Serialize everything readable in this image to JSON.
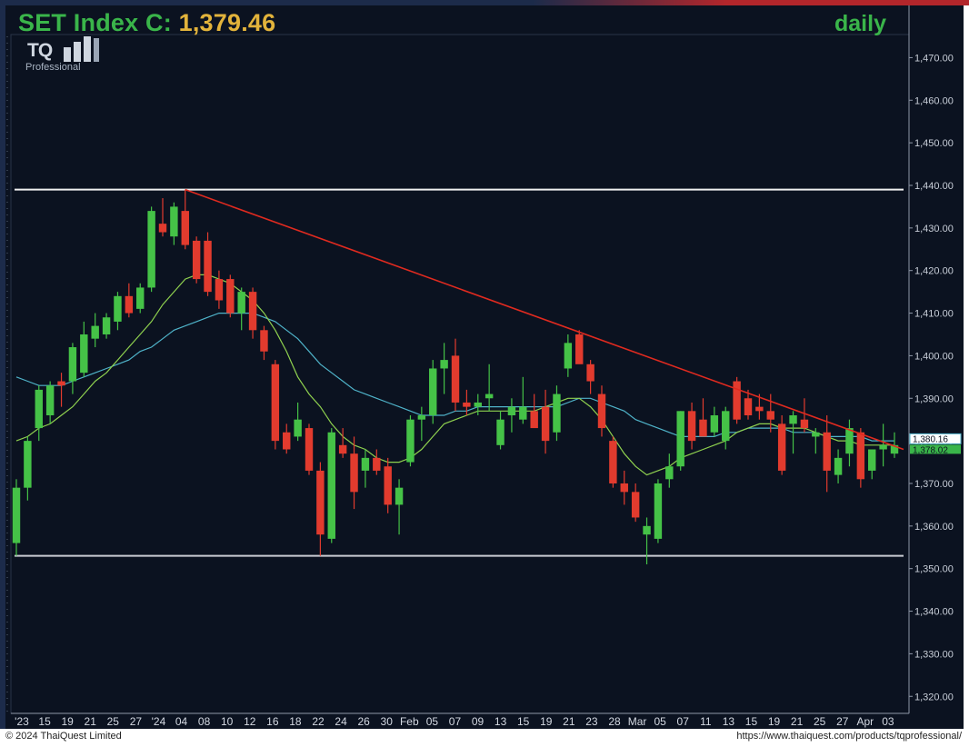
{
  "header": {
    "title_label": "SET Index C: ",
    "close_value": "1,379.46",
    "interval": "daily"
  },
  "logo": {
    "mark": "TQ",
    "subtitle": "Professional"
  },
  "footer": {
    "copyright": "© 2024 ThaiQuest Limited",
    "url": "https://www.thaiquest.com/products/tqprofessional/"
  },
  "colors": {
    "background": "#0b1220",
    "up": "#45c247",
    "down": "#e23b2e",
    "ma_fast": "#8fd14f",
    "ma_slow": "#4fb3c9",
    "trendline": "#e02a1f",
    "level_line": "#e6e6e6",
    "title": "#e2b33b"
  },
  "chart_data": {
    "type": "candlestick",
    "title": "SET Index C: 1,379.46",
    "interval": "daily",
    "ylim": [
      1316,
      1475
    ],
    "y_ticks": [
      "1,470.00",
      "1,460.00",
      "1,450.00",
      "1,440.00",
      "1,430.00",
      "1,420.00",
      "1,410.00",
      "1,400.00",
      "1,390.00",
      "1,380.00",
      "1,370.00",
      "1,360.00",
      "1,350.00",
      "1,340.00",
      "1,330.00",
      "1,320.00"
    ],
    "x_labels": [
      "'23",
      "15",
      "19",
      "21",
      "25",
      "27",
      "'24",
      "04",
      "08",
      "10",
      "12",
      "16",
      "18",
      "22",
      "24",
      "26",
      "30",
      "Feb",
      "05",
      "07",
      "09",
      "13",
      "15",
      "19",
      "21",
      "23",
      "28",
      "Mar",
      "05",
      "07",
      "11",
      "13",
      "15",
      "19",
      "21",
      "25",
      "27",
      "Apr",
      "03"
    ],
    "last_value_labels": [
      "1,380.16",
      "1,378.02"
    ],
    "candles": [
      {
        "o": 1356,
        "h": 1371,
        "l": 1353,
        "c": 1369
      },
      {
        "o": 1369,
        "h": 1381,
        "l": 1366,
        "c": 1380
      },
      {
        "o": 1383,
        "h": 1393,
        "l": 1380,
        "c": 1392
      },
      {
        "o": 1386,
        "h": 1394,
        "l": 1384,
        "c": 1393
      },
      {
        "o": 1394,
        "h": 1396,
        "l": 1388,
        "c": 1393
      },
      {
        "o": 1394,
        "h": 1403,
        "l": 1391,
        "c": 1402
      },
      {
        "o": 1396,
        "h": 1408,
        "l": 1395,
        "c": 1405
      },
      {
        "o": 1404,
        "h": 1410,
        "l": 1402,
        "c": 1407
      },
      {
        "o": 1405,
        "h": 1410,
        "l": 1404,
        "c": 1409
      },
      {
        "o": 1408,
        "h": 1415,
        "l": 1406,
        "c": 1414
      },
      {
        "o": 1414,
        "h": 1417,
        "l": 1409,
        "c": 1410
      },
      {
        "o": 1411,
        "h": 1417,
        "l": 1410,
        "c": 1416
      },
      {
        "o": 1416,
        "h": 1435,
        "l": 1415,
        "c": 1434
      },
      {
        "o": 1431,
        "h": 1437,
        "l": 1428,
        "c": 1429
      },
      {
        "o": 1428,
        "h": 1436,
        "l": 1426,
        "c": 1435
      },
      {
        "o": 1434,
        "h": 1439,
        "l": 1425,
        "c": 1426
      },
      {
        "o": 1427,
        "h": 1428,
        "l": 1417,
        "c": 1418
      },
      {
        "o": 1427,
        "h": 1429,
        "l": 1414,
        "c": 1415
      },
      {
        "o": 1418,
        "h": 1420,
        "l": 1411,
        "c": 1413
      },
      {
        "o": 1418,
        "h": 1419,
        "l": 1409,
        "c": 1410
      },
      {
        "o": 1410,
        "h": 1416,
        "l": 1406,
        "c": 1415
      },
      {
        "o": 1415,
        "h": 1416,
        "l": 1404,
        "c": 1406
      },
      {
        "o": 1406,
        "h": 1407,
        "l": 1399,
        "c": 1401
      },
      {
        "o": 1398,
        "h": 1399,
        "l": 1378,
        "c": 1380
      },
      {
        "o": 1382,
        "h": 1384,
        "l": 1377,
        "c": 1378
      },
      {
        "o": 1381,
        "h": 1389,
        "l": 1380,
        "c": 1385
      },
      {
        "o": 1383,
        "h": 1384,
        "l": 1372,
        "c": 1373
      },
      {
        "o": 1373,
        "h": 1375,
        "l": 1353,
        "c": 1358
      },
      {
        "o": 1357,
        "h": 1383,
        "l": 1356,
        "c": 1382
      },
      {
        "o": 1379,
        "h": 1383,
        "l": 1376,
        "c": 1377
      },
      {
        "o": 1377,
        "h": 1381,
        "l": 1364,
        "c": 1368
      },
      {
        "o": 1373,
        "h": 1378,
        "l": 1369,
        "c": 1376
      },
      {
        "o": 1376,
        "h": 1378,
        "l": 1372,
        "c": 1373
      },
      {
        "o": 1374,
        "h": 1376,
        "l": 1363,
        "c": 1365
      },
      {
        "o": 1365,
        "h": 1371,
        "l": 1358,
        "c": 1369
      },
      {
        "o": 1375,
        "h": 1386,
        "l": 1374,
        "c": 1385
      },
      {
        "o": 1385,
        "h": 1388,
        "l": 1380,
        "c": 1386
      },
      {
        "o": 1386,
        "h": 1399,
        "l": 1384,
        "c": 1397
      },
      {
        "o": 1397,
        "h": 1403,
        "l": 1391,
        "c": 1399
      },
      {
        "o": 1400,
        "h": 1404,
        "l": 1387,
        "c": 1389
      },
      {
        "o": 1389,
        "h": 1392,
        "l": 1386,
        "c": 1388
      },
      {
        "o": 1388,
        "h": 1391,
        "l": 1386,
        "c": 1389
      },
      {
        "o": 1390,
        "h": 1398,
        "l": 1387,
        "c": 1391
      },
      {
        "o": 1379,
        "h": 1387,
        "l": 1378,
        "c": 1385
      },
      {
        "o": 1386,
        "h": 1390,
        "l": 1382,
        "c": 1388
      },
      {
        "o": 1385,
        "h": 1395,
        "l": 1384,
        "c": 1388
      },
      {
        "o": 1387,
        "h": 1391,
        "l": 1385,
        "c": 1383
      },
      {
        "o": 1388,
        "h": 1392,
        "l": 1377,
        "c": 1380
      },
      {
        "o": 1382,
        "h": 1393,
        "l": 1380,
        "c": 1391
      },
      {
        "o": 1397,
        "h": 1405,
        "l": 1395,
        "c": 1403
      },
      {
        "o": 1405,
        "h": 1406,
        "l": 1399,
        "c": 1398
      },
      {
        "o": 1398,
        "h": 1399,
        "l": 1391,
        "c": 1394
      },
      {
        "o": 1391,
        "h": 1393,
        "l": 1381,
        "c": 1383
      },
      {
        "o": 1380,
        "h": 1381,
        "l": 1369,
        "c": 1370
      },
      {
        "o": 1370,
        "h": 1373,
        "l": 1365,
        "c": 1368
      },
      {
        "o": 1368,
        "h": 1370,
        "l": 1361,
        "c": 1362
      },
      {
        "o": 1358,
        "h": 1362,
        "l": 1351,
        "c": 1360
      },
      {
        "o": 1357,
        "h": 1371,
        "l": 1356,
        "c": 1370
      },
      {
        "o": 1371,
        "h": 1377,
        "l": 1369,
        "c": 1374
      },
      {
        "o": 1374,
        "h": 1387,
        "l": 1373,
        "c": 1387
      },
      {
        "o": 1387,
        "h": 1389,
        "l": 1378,
        "c": 1380
      },
      {
        "o": 1385,
        "h": 1390,
        "l": 1381,
        "c": 1381
      },
      {
        "o": 1382,
        "h": 1388,
        "l": 1381,
        "c": 1386
      },
      {
        "o": 1380,
        "h": 1388,
        "l": 1378,
        "c": 1387
      },
      {
        "o": 1394,
        "h": 1395,
        "l": 1384,
        "c": 1385
      },
      {
        "o": 1390,
        "h": 1392,
        "l": 1385,
        "c": 1386
      },
      {
        "o": 1388,
        "h": 1391,
        "l": 1385,
        "c": 1387
      },
      {
        "o": 1387,
        "h": 1391,
        "l": 1382,
        "c": 1385
      },
      {
        "o": 1384,
        "h": 1386,
        "l": 1372,
        "c": 1373
      },
      {
        "o": 1384,
        "h": 1387,
        "l": 1377,
        "c": 1386
      },
      {
        "o": 1385,
        "h": 1390,
        "l": 1382,
        "c": 1383
      },
      {
        "o": 1381,
        "h": 1383,
        "l": 1377,
        "c": 1382
      },
      {
        "o": 1382,
        "h": 1386,
        "l": 1368,
        "c": 1373
      },
      {
        "o": 1372,
        "h": 1378,
        "l": 1370,
        "c": 1376
      },
      {
        "o": 1377,
        "h": 1385,
        "l": 1374,
        "c": 1383
      },
      {
        "o": 1382,
        "h": 1383,
        "l": 1369,
        "c": 1371
      },
      {
        "o": 1373,
        "h": 1376,
        "l": 1371,
        "c": 1378
      },
      {
        "o": 1378,
        "h": 1384,
        "l": 1374,
        "c": 1379
      },
      {
        "o": 1377,
        "h": 1382,
        "l": 1376,
        "c": 1379
      }
    ],
    "ma_fast": [
      1380,
      1381,
      1383,
      1384,
      1386,
      1388,
      1391,
      1394,
      1396,
      1399,
      1402,
      1405,
      1408,
      1412,
      1415,
      1418,
      1419,
      1419,
      1418,
      1417,
      1415,
      1413,
      1410,
      1406,
      1401,
      1395,
      1391,
      1388,
      1384,
      1381,
      1379,
      1378,
      1376,
      1375,
      1375,
      1376,
      1378,
      1381,
      1384,
      1385,
      1386,
      1387,
      1387,
      1387,
      1387,
      1387,
      1387,
      1388,
      1389,
      1390,
      1390,
      1388,
      1385,
      1381,
      1377,
      1374,
      1372,
      1373,
      1374,
      1376,
      1377,
      1378,
      1379,
      1380,
      1382,
      1383,
      1384,
      1384,
      1383,
      1383,
      1383,
      1382,
      1381,
      1380,
      1380,
      1379,
      1379,
      1379,
      1379
    ],
    "ma_slow": [
      1395,
      1394,
      1393,
      1393,
      1393,
      1394,
      1395,
      1396,
      1397,
      1398,
      1399,
      1401,
      1402,
      1404,
      1406,
      1407,
      1408,
      1409,
      1410,
      1410,
      1410,
      1410,
      1409,
      1408,
      1406,
      1404,
      1401,
      1398,
      1396,
      1394,
      1392,
      1391,
      1390,
      1389,
      1388,
      1387,
      1386,
      1386,
      1386,
      1387,
      1387,
      1388,
      1388,
      1388,
      1388,
      1388,
      1388,
      1388,
      1388,
      1389,
      1390,
      1390,
      1389,
      1388,
      1387,
      1385,
      1384,
      1383,
      1382,
      1381,
      1381,
      1381,
      1381,
      1382,
      1382,
      1383,
      1383,
      1383,
      1383,
      1382,
      1382,
      1382,
      1381,
      1381,
      1381,
      1381,
      1380,
      1380,
      1380
    ],
    "horizontal_levels": [
      1439,
      1353
    ],
    "trendline": {
      "from": {
        "index": 15,
        "value": 1439
      },
      "to_value_at_end": 1378
    }
  }
}
